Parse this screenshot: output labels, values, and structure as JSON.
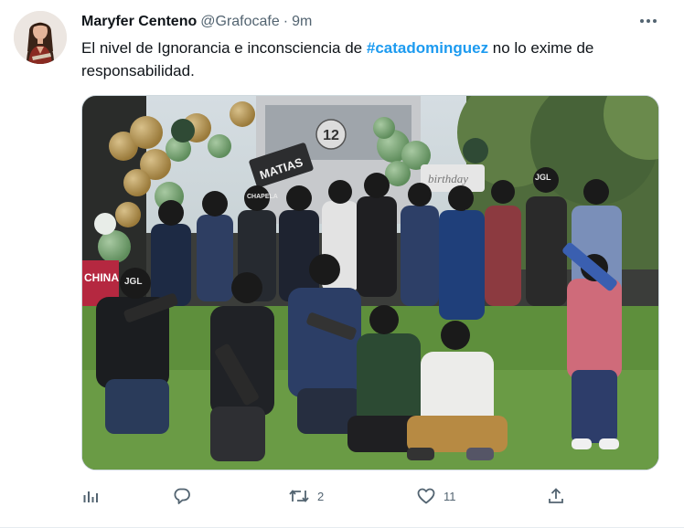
{
  "tweet": {
    "author_name": "Maryfer Centeno",
    "handle": "@Grafocafe",
    "separator": "·",
    "time": "9m",
    "text_before": "El nivel de Ignorancia e inconsciencia de ",
    "hashtag": "#catadominguez",
    "text_after": " no lo exime de responsabilidad."
  },
  "photo": {
    "sign_name": "MATIAS",
    "number_badge": "12",
    "banner_text": "CHINA",
    "birthday_text": "birthday",
    "cap_text": "JGL",
    "cap_text_alt": "CHAPELA"
  },
  "actions": {
    "views_icon": "analytics-icon",
    "reply_icon": "reply-icon",
    "retweet_icon": "retweet-icon",
    "retweet_count": "2",
    "like_icon": "heart-icon",
    "like_count": "11",
    "share_icon": "share-icon"
  },
  "colors": {
    "hashtag": "#1d9bf0",
    "secondary_text": "#536471",
    "primary_text": "#0f1419"
  }
}
